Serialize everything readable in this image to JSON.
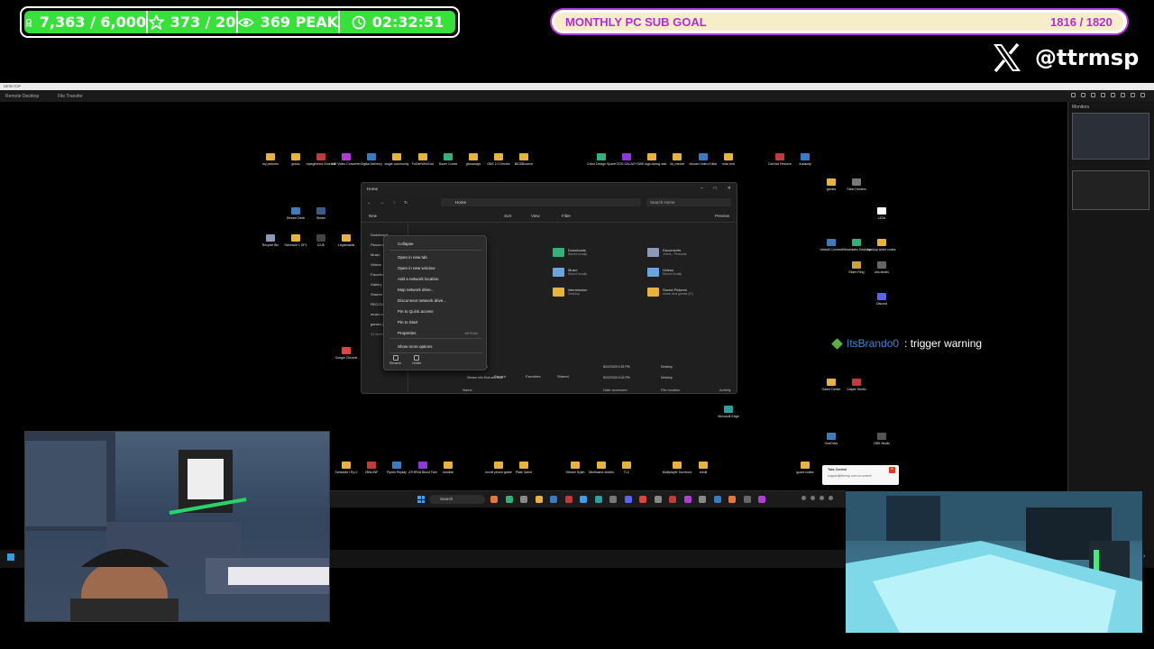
{
  "stream_stats": {
    "followers": "7,363 / 6,000",
    "stars": "373 / 20",
    "peak_viewers": "369 PEAK",
    "uptime": "02:32:51",
    "accent": "#36e23a"
  },
  "sub_goal": {
    "label": "MONTHLY PC SUB GOAL",
    "progress_text": "1816 / 1820",
    "progress": 0.998,
    "accent": "#b82ad8"
  },
  "social": {
    "platform_icon": "x-logo-icon",
    "handle": "@ttrmsp"
  },
  "remote_desktop": {
    "window_title": "DESKTOP",
    "toolbar_tab1": "Remote Desktop",
    "toolbar_tab2": "File Transfer",
    "monitors_title": "Monitors"
  },
  "desktop_icons": [
    {
      "label": "my pictures",
      "color": "#e8b33c"
    },
    {
      "label": "gravis",
      "color": "#e8b33c"
    },
    {
      "label": "mpegtheora Shortcut",
      "color": "#c23a3a"
    },
    {
      "label": "HD Video Converter",
      "color": "#b33cd6"
    },
    {
      "label": "Digital Alchemy",
      "color": "#3a7cc2"
    },
    {
      "label": "single community",
      "color": "#e8b33c"
    },
    {
      "label": "FuDefrWebTool",
      "color": "#e8b33c"
    },
    {
      "label": "Razer Cortex",
      "color": "#2fb37a"
    },
    {
      "label": "giveaways",
      "color": "#e8b33c"
    },
    {
      "label": "OBS 2.0 Dexthe",
      "color": "#e8b33c"
    },
    {
      "label": "BIOSBoomer",
      "color": "#e8b33c"
    },
    {
      "label": "Cricut Design Space",
      "color": "#2fb37a"
    },
    {
      "label": "GOG GALAXY",
      "color": "#8b3ad6"
    },
    {
      "label": "OBS logs during wks",
      "color": "#e8b33c"
    },
    {
      "label": "3d_minute",
      "color": "#e8b33c"
    },
    {
      "label": "Movavi Video Editor",
      "color": "#3a7cc2"
    },
    {
      "label": "misc text",
      "color": "#e8b33c"
    },
    {
      "label": "DaVinci Resolve",
      "color": "#c23a3a"
    },
    {
      "label": "Audacity",
      "color": "#3a7cc2"
    },
    {
      "label": "Recycle Bin",
      "color": "#8b9ab5"
    },
    {
      "label": "Schedule 1 DP1",
      "color": "#e8b33c"
    },
    {
      "label": "iCUE",
      "color": "#444"
    },
    {
      "label": "Legoinstalls",
      "color": "#e8b33c"
    },
    {
      "label": "games",
      "color": "#e8b33c"
    },
    {
      "label": "Steel Hunters",
      "color": "#777"
    },
    {
      "label": "LEDs",
      "color": "#fff"
    },
    {
      "label": "Ubisoft Connect",
      "color": "#3a7cc2"
    },
    {
      "label": "Streamlabs Desktop",
      "color": "#2fb37a"
    },
    {
      "label": "backup sided codes",
      "color": "#e8b33c"
    },
    {
      "label": "Elden Ring",
      "color": "#c9a23a"
    },
    {
      "label": "Stream Deck",
      "color": "#3a7cc2"
    },
    {
      "label": "Steam",
      "color": "#3a5a8a"
    },
    {
      "label": "obs-studio",
      "color": "#666"
    },
    {
      "label": "Google Chrome",
      "color": "#e0443a"
    },
    {
      "label": "Firefox",
      "color": "#e8763a"
    },
    {
      "label": "Microsoft Edge",
      "color": "#2fa0a0"
    },
    {
      "label": "Discord",
      "color": "#5865f2"
    },
    {
      "label": "Game Center",
      "color": "#e8b33c"
    },
    {
      "label": "Diaper Studio",
      "color": "#c23a3a"
    },
    {
      "label": "OneDrive",
      "color": "#3a7cc2"
    },
    {
      "label": "OBS Studio",
      "color": "#555"
    },
    {
      "label": "Multiplayer Survivors",
      "color": "#e8b33c"
    },
    {
      "label": "Stream Sylph",
      "color": "#e8b33c"
    },
    {
      "label": "Medhasne deaths",
      "color": "#e8b33c"
    },
    {
      "label": "TLC",
      "color": "#e8b33c"
    },
    {
      "label": "Schedule I Rp 2",
      "color": "#e8b33c"
    },
    {
      "label": "2Bits INF",
      "color": "#c23a3a"
    },
    {
      "label": "Ryzen Replay",
      "color": "#3a7cc2"
    },
    {
      "label": "ATHENA Blood Twin",
      "color": "#8b3ad6"
    },
    {
      "label": "dundlan",
      "color": "#e8b33c"
    },
    {
      "label": "movie phone game",
      "color": "#e8b33c"
    },
    {
      "label": "Plate Game",
      "color": "#e8b33c"
    },
    {
      "label": "credit",
      "color": "#e8b33c"
    },
    {
      "label": "guard codes",
      "color": "#e8b33c"
    }
  ],
  "explorer": {
    "title": "Home",
    "address": "Home",
    "search_placeholder": "Search Home",
    "cmd_new": "New",
    "cmd_sort": "Sort",
    "cmd_view": "View",
    "cmd_filter": "Filter",
    "cmd_preview": "Preview",
    "nav_items": [
      "Downloads",
      "Pictures",
      "Music",
      "Videos",
      "Favorites",
      "Gallery",
      "Shared",
      "RECOVERY (D:)",
      "music and games (E:)"
    ],
    "nav_status": "31 items",
    "quick_access": [
      {
        "name": "Downloads",
        "sub": "Stored locally",
        "color": "green"
      },
      {
        "name": "Music",
        "sub": "Stored locally",
        "color": "blue"
      },
      {
        "name": "intermission",
        "sub": "Desktop",
        "color": "yellow"
      },
      {
        "name": "Documents",
        "sub": "Johns - Personal",
        "color": "gray"
      },
      {
        "name": "Videos",
        "sub": "Stored locally",
        "color": "blue"
      },
      {
        "name": "Saved Pictures",
        "sub": "music and games (E:)",
        "color": "yellow"
      }
    ],
    "tabs": [
      "Recent",
      "Favorites",
      "Shared"
    ],
    "headers": [
      "Name",
      "Date accessed",
      "File location",
      "Activity"
    ],
    "files": [
      {
        "name": "Stream Master",
        "date": "8/22/2025 9:25 PM",
        "loc": "Desktop"
      },
      {
        "name": "Stream info Kick and dual",
        "date": "8/22/2025 9:03 PM",
        "loc": "Desktop"
      }
    ]
  },
  "context_menu": {
    "items": [
      {
        "label": "Collapse",
        "kb": ""
      },
      {
        "label": "Open in new tab",
        "kb": ""
      },
      {
        "label": "Open in new window",
        "kb": ""
      },
      {
        "label": "Add a network location",
        "kb": ""
      },
      {
        "label": "Map network drive...",
        "kb": ""
      },
      {
        "label": "Disconnect network drive...",
        "kb": ""
      },
      {
        "label": "Pin to Quick access",
        "kb": ""
      },
      {
        "label": "Pin to Start",
        "kb": ""
      },
      {
        "label": "Properties",
        "kb": "Alt+Enter"
      },
      {
        "label": "Show more options",
        "kb": ""
      }
    ],
    "bottom": [
      "Rename",
      "Delete"
    ]
  },
  "taskbar": {
    "search_placeholder": "Search"
  },
  "notification": {
    "title": "Take Control",
    "body": "support@ttrmsp.com on screen"
  },
  "chat": {
    "user": "ItsBrando0",
    "message": ": trigger warning"
  }
}
